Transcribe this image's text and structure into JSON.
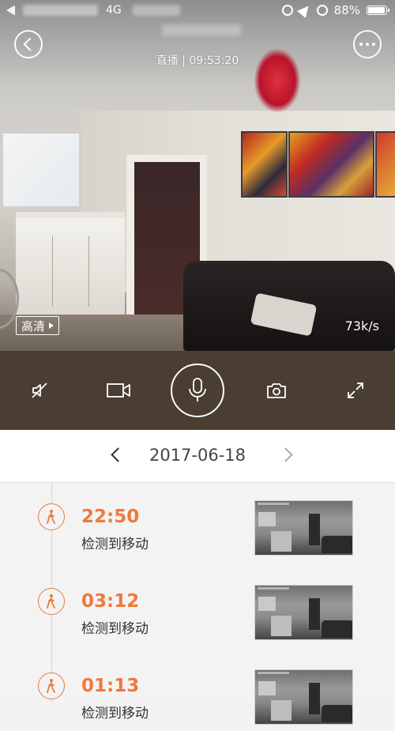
{
  "status_bar": {
    "network": "4G",
    "battery_percent": "88%",
    "battery_level": 0.88
  },
  "live": {
    "label": "直播",
    "separator": "|",
    "time": "09:53:20",
    "quality_label": "高清",
    "speed": "73k/s"
  },
  "controls": {
    "icons": [
      "mute-icon",
      "record-icon",
      "microphone-icon",
      "camera-icon",
      "fullscreen-icon"
    ]
  },
  "date_bar": {
    "date": "2017-06-18"
  },
  "events": [
    {
      "time": "22:50",
      "label": "检测到移动"
    },
    {
      "time": "03:12",
      "label": "检测到移动"
    },
    {
      "time": "01:13",
      "label": "检测到移动"
    }
  ],
  "colors": {
    "accent": "#ee7a3c",
    "control_bar": "#4a3d31"
  }
}
